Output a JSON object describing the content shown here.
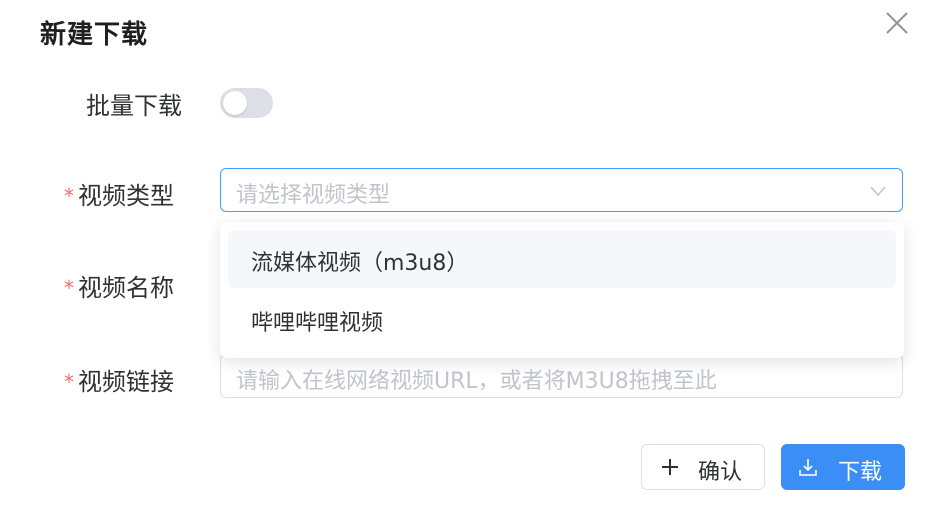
{
  "dialog": {
    "title": "新建下载"
  },
  "form": {
    "batch_label": "批量下载",
    "batch_enabled": false,
    "required_mark": "*",
    "type_label": "视频类型",
    "type_placeholder": "请选择视频类型",
    "name_label": "视频名称",
    "link_label": "视频链接",
    "link_placeholder": "请输入在线网络视频URL，或者将M3U8拖拽至此"
  },
  "dropdown": {
    "options": [
      {
        "label": "流媒体视频（m3u8）"
      },
      {
        "label": "哔哩哔哩视频"
      }
    ]
  },
  "buttons": {
    "confirm_label": "确认",
    "download_label": "下载"
  },
  "colors": {
    "primary": "#3a8ef6",
    "focus_border": "#409eff",
    "required": "#f56c6c",
    "placeholder": "#c0c4cc"
  },
  "icons": {
    "close": "close-icon",
    "arrow": "chevron-down-icon",
    "plus": "plus-icon",
    "download": "download-icon"
  }
}
